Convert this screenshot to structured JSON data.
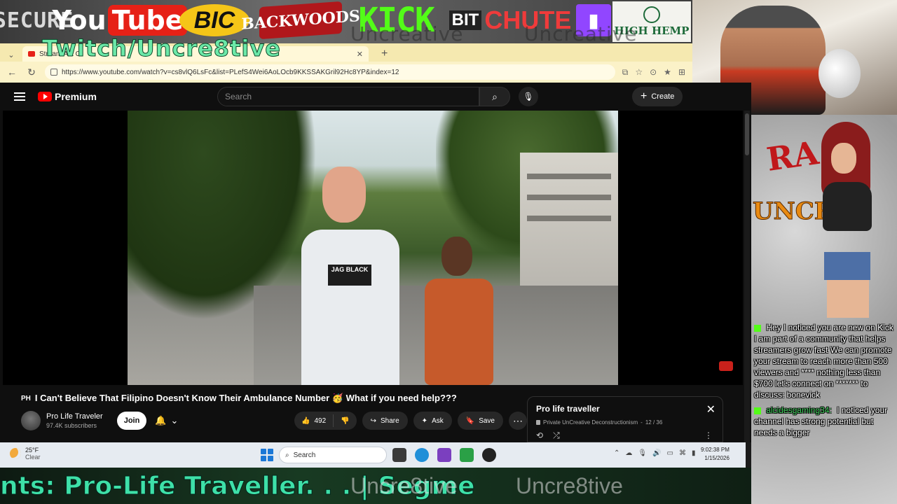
{
  "banner": {
    "sponsors": [
      "SECURE",
      "YouTube",
      "BIC",
      "BACKWOODS",
      "KICK",
      "BIT CHUTE",
      "Twitch",
      "HIGH HEMP"
    ],
    "ghost_text": "Uncreative",
    "overlay_handle": "Twitch/Uncre8tive"
  },
  "browser": {
    "tab_title": "Stream Act Of",
    "url": "https://www.youtube.com/watch?v=cs8vlQ6LsFc&list=PLefS4Wei6AoLOcb9KKSSAKGril92Hc8YP&index=12"
  },
  "youtube": {
    "brand": "Premium",
    "search_placeholder": "Search",
    "create_label": "Create",
    "video": {
      "title_prefix": "PH",
      "title": "I Can't Believe That Filipino Doesn't Know Their Ambulance Number 🥳 What if you need help???",
      "shirt_text": "JAG BLACK"
    },
    "channel": {
      "name": "Pro Life Traveler",
      "subscribers": "97.4K subscribers",
      "join_label": "Join"
    },
    "actions": {
      "likes": "492",
      "share": "Share",
      "ask": "Ask",
      "save": "Save"
    },
    "playlist": {
      "title": "Pro life traveller",
      "meta": "Private UnCreative Deconstructionism",
      "position": "12 / 36"
    }
  },
  "taskbar": {
    "temperature": "25°F",
    "condition": "Clear",
    "search_label": "Search",
    "time": "9:02:38 PM",
    "date": "1/15/2026"
  },
  "side_panel": {
    "rad_text": "RA",
    "uncr_text": "UNCR",
    "chat": [
      {
        "user": "",
        "text": "Hey I noticed you are new on Kick I am part of a community that helps streamers grow fast We can promote your stream to reach more than 500 viewers and **** nothing less than $700 let's connect on ******* to discuss: bonevick"
      },
      {
        "user": "alcidesgaming34:",
        "text": "I noticed your channel has strong potential but needs a bigger"
      }
    ]
  },
  "ticker": {
    "text": "nts: Pro-Life Traveller. . . | Segme",
    "ghost_1": "Uncre8tive",
    "ghost_2": "Uncre8tive"
  },
  "colors": {
    "yt_bg": "#0f0f0f",
    "yt_red": "#ff0000",
    "kick_green": "#53fc18",
    "twitch_purple": "#9146ff",
    "ticker_green": "#3ee0a8"
  }
}
